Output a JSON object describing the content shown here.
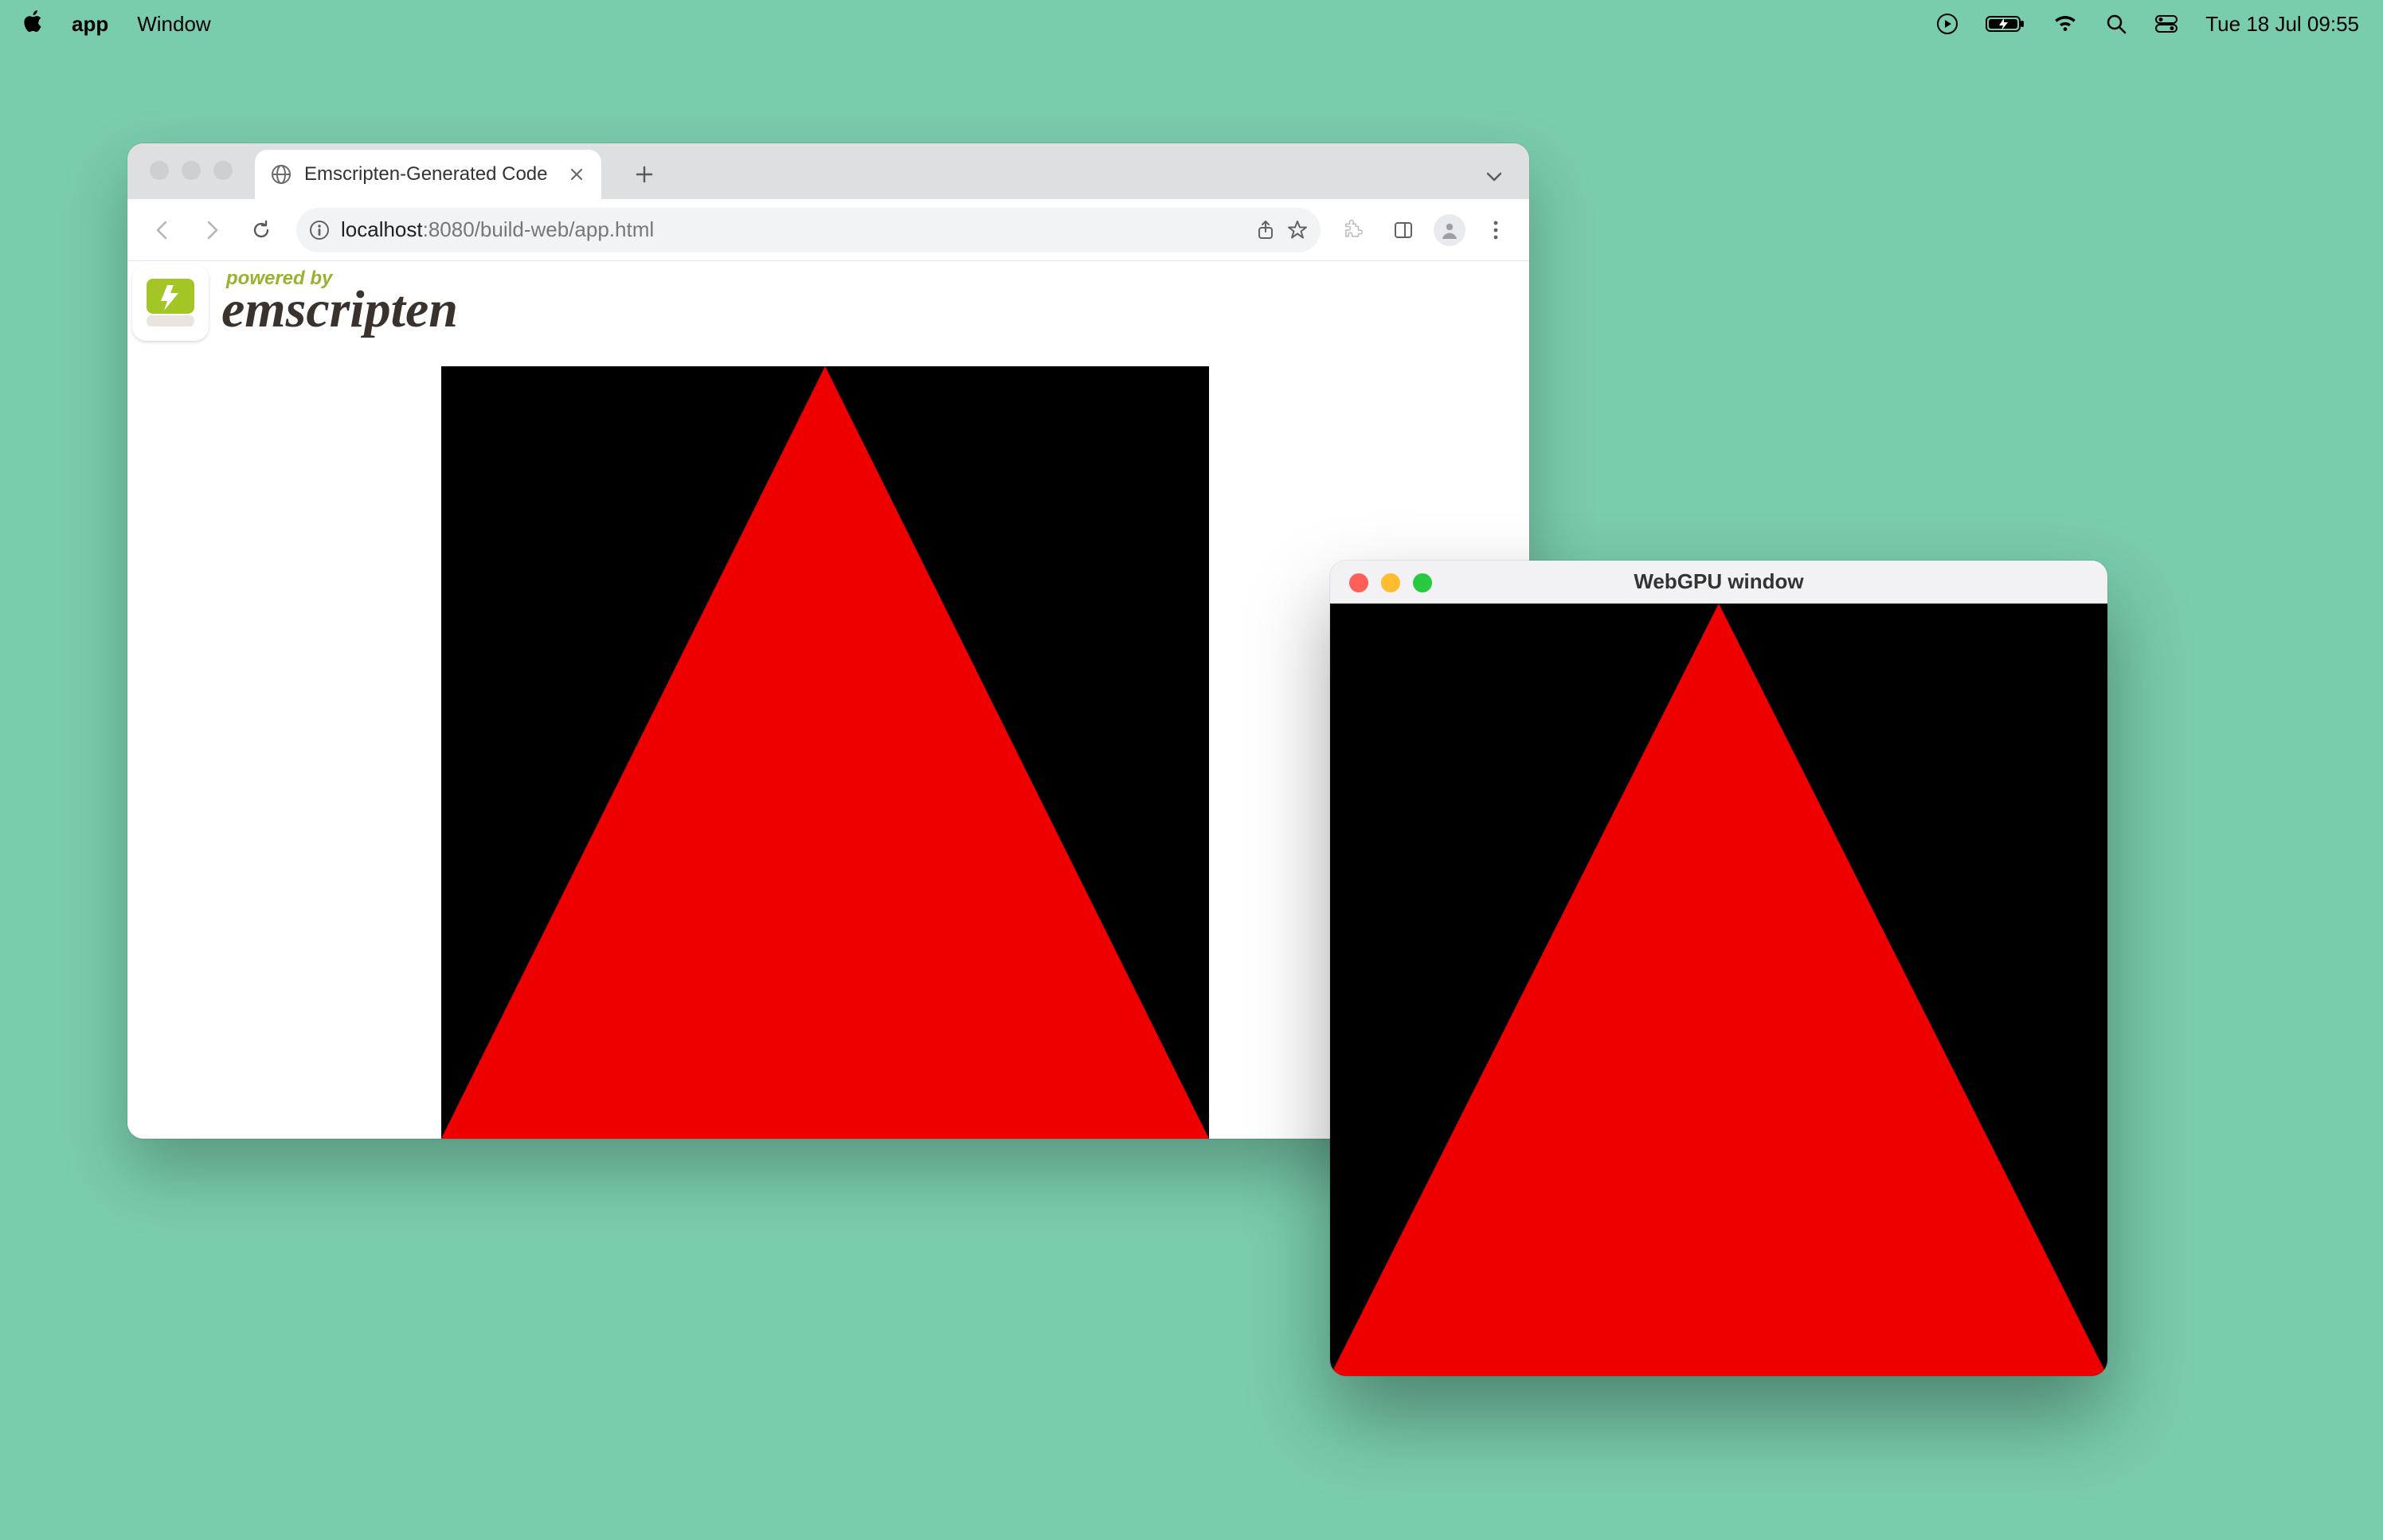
{
  "menubar": {
    "app_name": "app",
    "menus": [
      "Window"
    ],
    "clock": "Tue 18 Jul  09:55"
  },
  "browser": {
    "tab": {
      "title": "Emscripten-Generated Code"
    },
    "url": {
      "host": "localhost",
      "port_and_path": ":8080/build-web/app.html"
    },
    "emscripten": {
      "powered_by": "powered by",
      "name": "emscripten"
    }
  },
  "native": {
    "title": "WebGPU window"
  },
  "colors": {
    "desktop": "#79ccac",
    "triangle": "#ef0000",
    "canvas_bg": "#000000"
  }
}
